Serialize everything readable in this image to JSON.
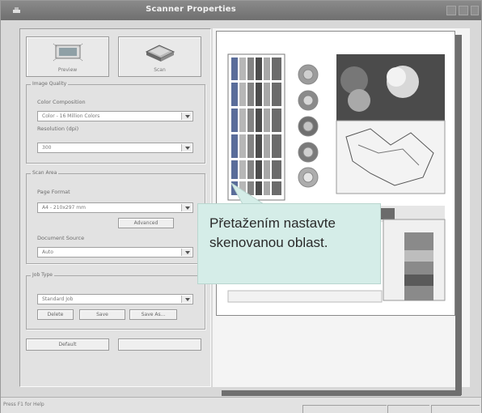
{
  "window": {
    "title": "Scanner Properties"
  },
  "actions": {
    "preview_label": "Preview",
    "scan_label": "Scan"
  },
  "image_quality": {
    "group_label": "Image Quality",
    "color_label": "Color Composition",
    "color_value": "Color - 16 Million Colors",
    "resolution_label": "Resolution (dpi)",
    "resolution_value": "300"
  },
  "scan_area": {
    "group_label": "Scan Area",
    "page_format_label": "Page Format",
    "page_format_value": "A4 - 210x297 mm",
    "advanced_label": "Advanced",
    "source_label": "Document Source",
    "source_value": "Auto"
  },
  "job_type": {
    "group_label": "Job Type",
    "job_value": "Standard Job",
    "delete_label": "Delete",
    "save_label": "Save",
    "save_as_label": "Save As..."
  },
  "bottom": {
    "default_label": "Default"
  },
  "callout": {
    "text": "Přetažením nastavte skenovanou oblast."
  },
  "status": {
    "text": "Press F1 for Help"
  },
  "colors": {
    "callout_bg": "#d5ede8",
    "titlebar": "#7c7c7c",
    "panel": "#e2e2e2"
  }
}
